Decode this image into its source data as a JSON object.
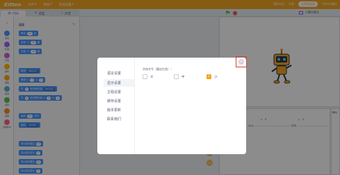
{
  "menubar": {
    "logo": "Kitten",
    "menu": [
      "文件",
      "教程",
      "其他设置"
    ],
    "right": [
      "我的作品",
      "分享",
      "Python模式"
    ],
    "pill": "上传至社区"
  },
  "tabs": [
    {
      "label": "代码",
      "icon": "code-icon"
    },
    {
      "label": "造型",
      "icon": "brush-icon"
    },
    {
      "label": "声音",
      "icon": "speaker-icon"
    }
  ],
  "stage_mode": {
    "label": "小舞台模式"
  },
  "categories": [
    {
      "label": "运动",
      "color": "#4c97ff"
    },
    {
      "label": "外观",
      "color": "#9966ff"
    },
    {
      "label": "声音",
      "color": "#cf63cf"
    },
    {
      "label": "事件",
      "color": "#ffbf00"
    },
    {
      "label": "控制",
      "color": "#ffab19"
    },
    {
      "label": "侦测",
      "color": "#5cb1d6"
    },
    {
      "label": "运算",
      "color": "#59c059"
    },
    {
      "label": "变量",
      "color": "#ff8c1a"
    },
    {
      "label": "自制积木",
      "color": "#ff6680"
    }
  ],
  "palette": {
    "title": "运动",
    "blocks": [
      {
        "parts": [
          "移动",
          "10",
          "步"
        ]
      },
      {
        "parts": [
          "右转",
          "15",
          "度"
        ]
      },
      {
        "parts": [
          "左转",
          "15",
          "度"
        ]
      },
      {
        "parts": [
          "移到",
          "随机位置"
        ]
      },
      {
        "parts": [
          "移到 x:",
          "0",
          "y:",
          "0"
        ]
      },
      {
        "parts": [
          "在",
          "1",
          "秒内滑行到",
          "随机位置"
        ]
      },
      {
        "parts": [
          "在",
          "1",
          "秒内滑行到 x:",
          "0",
          "y:",
          "0"
        ]
      },
      {
        "parts": [
          "面向",
          "90",
          "方向"
        ]
      },
      {
        "parts": [
          "面向",
          "鼠标指针"
        ]
      },
      {
        "parts": [
          "将x坐标增加",
          "10"
        ]
      },
      {
        "parts": [
          "将x坐标设为",
          "0"
        ]
      },
      {
        "parts": [
          "将y坐标增加",
          "10"
        ]
      },
      {
        "parts": [
          "将y坐标设为",
          "0"
        ]
      }
    ]
  },
  "zoom": {
    "in": "+",
    "out": "−"
  },
  "sprite_info": {
    "x_label": "x",
    "x_value": "0",
    "y_label": "y",
    "y_value": "0",
    "size_label": "大小",
    "direction_label": "方向"
  },
  "stage_side": {
    "label": "舞台"
  },
  "modal": {
    "sidebar": [
      "语言设置",
      "显示设置",
      "主题设置",
      "缓存设置",
      "版本更新",
      "联系我们"
    ],
    "active_index": 1,
    "section_title": "字体字号（重启生效）：",
    "options": [
      {
        "label": "大",
        "checked": false
      },
      {
        "label": "中",
        "checked": false
      },
      {
        "label": "小",
        "checked": true
      }
    ],
    "close": "×"
  }
}
